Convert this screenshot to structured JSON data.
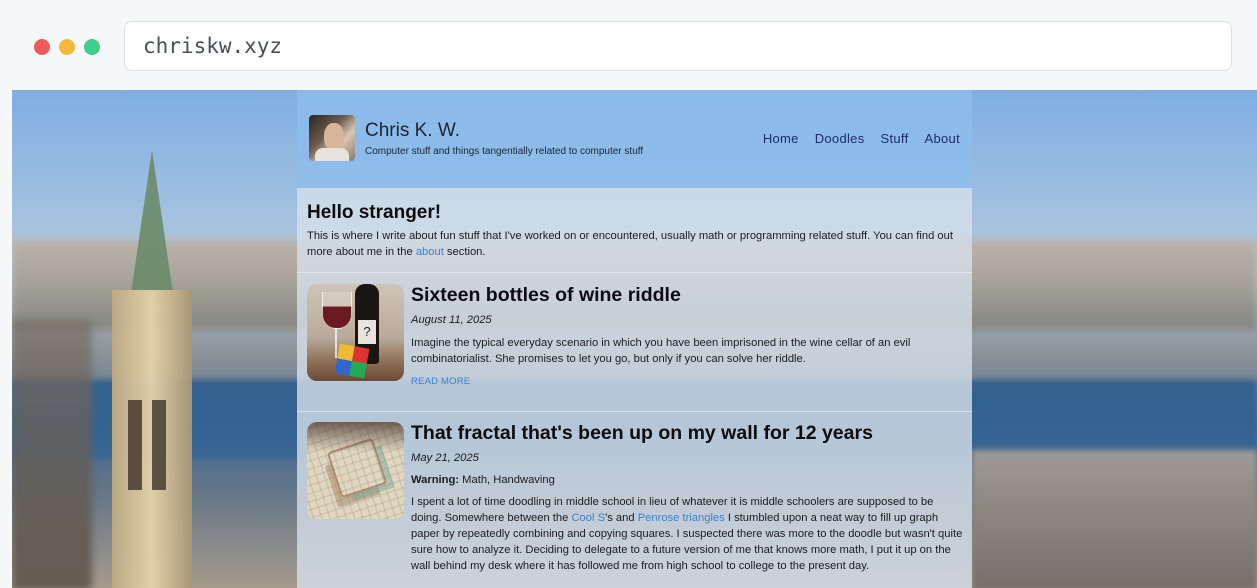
{
  "browser": {
    "url": "chriskw.xyz",
    "traffic_lights": {
      "close": "#ee5a5a",
      "minimize": "#f5b938",
      "maximize": "#3fce8c"
    }
  },
  "site": {
    "title": "Chris K. W.",
    "tagline": "Computer stuff and things tangentially related to computer stuff",
    "nav": [
      "Home",
      "Doodles",
      "Stuff",
      "About"
    ]
  },
  "intro": {
    "heading": "Hello stranger!",
    "text_before": "This is where I write about fun stuff that I've worked on or encountered, usually math or programming related stuff. You can find out more about me in the ",
    "link": "about",
    "text_after": " section."
  },
  "posts": [
    {
      "title": "Sixteen bottles of wine riddle",
      "date": "August 11, 2025",
      "summary": "Imagine the typical everyday scenario in which you have been imprisoned in the wine cellar of an evil combinatorialist. She promises to let you go, but only if you can solve her riddle.",
      "read_more": "READ MORE"
    },
    {
      "title": "That fractal that's been up on my wall for 12 years",
      "date": "May 21, 2025",
      "warning_label": "Warning:",
      "warning_text": " Math, Handwaving",
      "summary_1": "I spent a lot of time doodling in middle school in lieu of whatever it is middle schoolers are supposed to be doing. Somewhere between the ",
      "link_1": "Cool S",
      "summary_2": "'s and ",
      "link_2": "Penrose triangles",
      "summary_3": " I stumbled upon a neat way to fill up graph paper by repeatedly combining and copying squares. I suspected there was more to the doodle but wasn't quite sure how to analyze it. Deciding to delegate to a future version of me that knows more math, I put it up on the wall behind my desk where it has followed me from high school to college to the present day."
    }
  ],
  "colors": {
    "header_bg": "#8ebdeb",
    "nav_link": "#1e2a6e",
    "link": "#3e7fcf"
  }
}
